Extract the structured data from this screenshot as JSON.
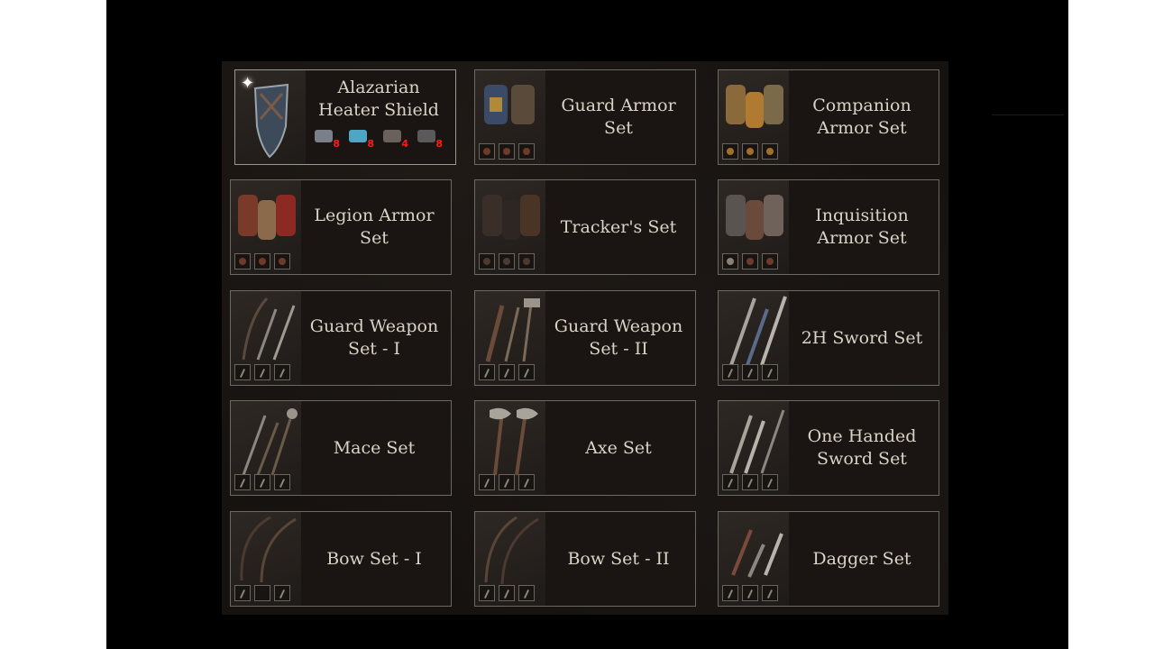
{
  "cards": [
    {
      "title": "Alazarian Heater Shield",
      "slots": [],
      "materials": [
        {
          "icon": "ore-chunk-icon",
          "count": "8",
          "color": "#7b7f8a"
        },
        {
          "icon": "crystal-ore-icon",
          "count": "8",
          "color": "#4fa6c4"
        },
        {
          "icon": "iron-shard-icon",
          "count": "4",
          "color": "#6b615c"
        },
        {
          "icon": "coal-icon",
          "count": "8",
          "color": "#5a5a5a"
        }
      ]
    },
    {
      "title": "Guard Armor Set",
      "slots": [
        "armor",
        "armor",
        "armor"
      ]
    },
    {
      "title": "Companion Armor Set",
      "slots": [
        "armor",
        "armor",
        "armor"
      ]
    },
    {
      "title": "Legion Armor Set",
      "slots": [
        "armor",
        "armor",
        "armor"
      ]
    },
    {
      "title": "Tracker's Set",
      "slots": [
        "armor",
        "armor",
        "armor"
      ]
    },
    {
      "title": "Inquisition Armor Set",
      "slots": [
        "armor",
        "armor",
        "armor"
      ]
    },
    {
      "title": "Guard Weapon Set - I",
      "slots": [
        "weapon",
        "weapon",
        "weapon"
      ]
    },
    {
      "title": "Guard Weapon Set - II",
      "slots": [
        "weapon",
        "weapon",
        "weapon"
      ]
    },
    {
      "title": "2H Sword Set",
      "slots": [
        "weapon",
        "weapon",
        "weapon"
      ]
    },
    {
      "title": "Mace Set",
      "slots": [
        "weapon",
        "weapon",
        "weapon"
      ]
    },
    {
      "title": "Axe Set",
      "slots": [
        "weapon",
        "weapon",
        "weapon"
      ]
    },
    {
      "title": "One Handed Sword Set",
      "slots": [
        "weapon",
        "weapon",
        "weapon"
      ]
    },
    {
      "title": "Bow Set - I",
      "slots": [
        "weapon",
        "weapon",
        "weapon"
      ]
    },
    {
      "title": "Bow Set - II",
      "slots": [
        "weapon",
        "weapon",
        "weapon"
      ]
    },
    {
      "title": "Dagger Set",
      "slots": [
        "weapon",
        "weapon",
        "weapon"
      ]
    }
  ],
  "colors": {
    "panel_bg": "#161210",
    "card_border": "#6d6862",
    "title_text": "#d9d3c6",
    "material_count": "#ff1a1a"
  }
}
